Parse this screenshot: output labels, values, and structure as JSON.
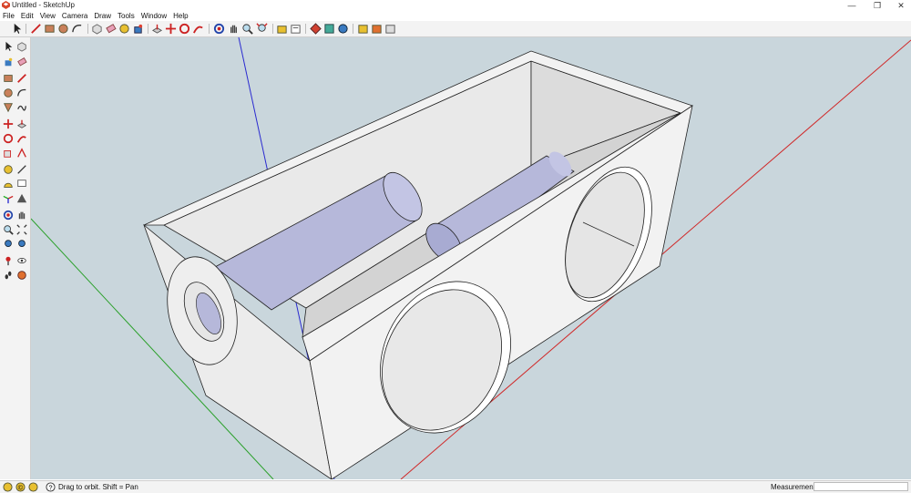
{
  "window": {
    "title": "Untitled - SketchUp",
    "minimize": "—",
    "maximize": "❐",
    "close": "✕"
  },
  "menu": [
    "File",
    "Edit",
    "View",
    "Camera",
    "Draw",
    "Tools",
    "Window",
    "Help"
  ],
  "toolbar_icons": [
    "select-icon",
    "line-icon",
    "rectangle-icon",
    "circle-icon",
    "arc-icon",
    "make-component-icon",
    "eraser-icon",
    "tape-measure-icon",
    "paint-bucket-icon",
    "push-pull-icon",
    "move-icon",
    "rotate-icon",
    "follow-me-icon",
    "orbit-icon",
    "pan-icon",
    "zoom-icon",
    "zoom-extents-icon",
    "warehouse-icon",
    "extension-icon",
    "styles-icon",
    "section-icon",
    "layout-icon",
    "share-model-icon"
  ],
  "status": {
    "hint": "Drag to orbit.  Shift = Pan",
    "measurements_label": "Measurements",
    "measurements_value": ""
  },
  "colors": {
    "viewport_bg": "#c9d6dc",
    "red_axis": "#d02828",
    "green_axis": "#2aa02a",
    "blue_axis": "#2a2ad0",
    "face": "#f2f2f2",
    "cylinder": "#b6b8da"
  }
}
